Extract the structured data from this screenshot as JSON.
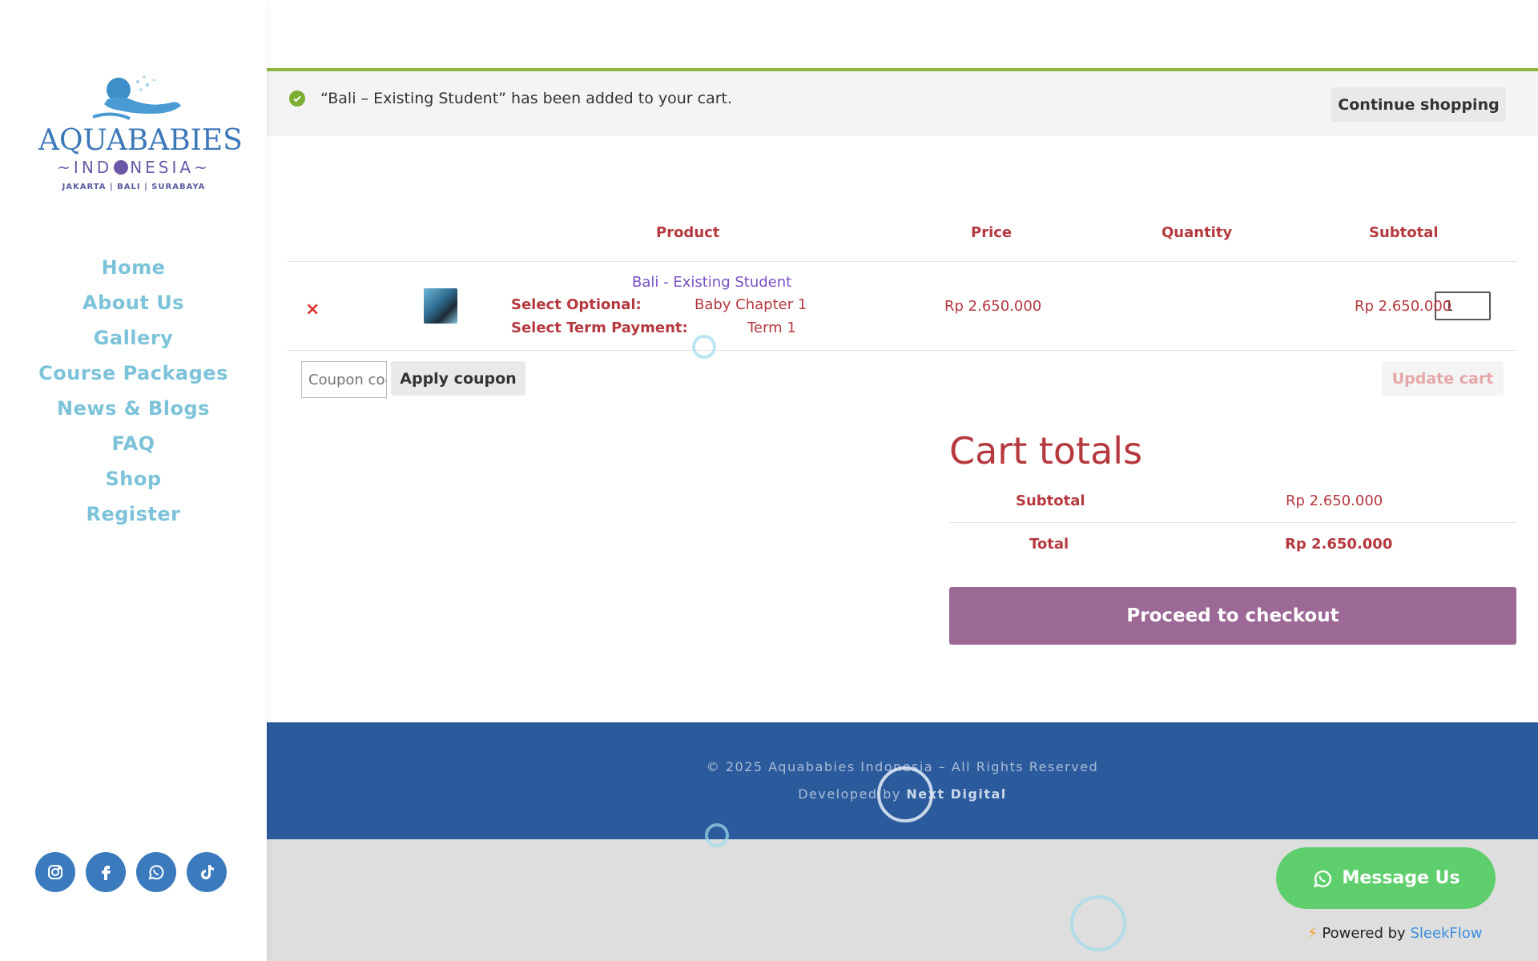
{
  "sidebar": {
    "logo": {
      "word": "AQUABABIES",
      "sub_before": "~IND",
      "sub_after": "NESIA~",
      "cities": "JAKARTA | BALI | SURABAYA"
    },
    "nav": [
      "Home",
      "About Us",
      "Gallery",
      "Course Packages",
      "News & Blogs",
      "FAQ",
      "Shop",
      "Register"
    ],
    "social": [
      "instagram-icon",
      "facebook-icon",
      "whatsapp-icon",
      "tiktok-icon"
    ]
  },
  "notice": {
    "message": "“Bali – Existing Student” has been added to your cart.",
    "continue_label": "Continue shopping"
  },
  "cart": {
    "headers": {
      "product": "Product",
      "price": "Price",
      "quantity": "Quantity",
      "subtotal": "Subtotal"
    },
    "item": {
      "remove": "×",
      "name": "Bali - Existing Student",
      "meta": [
        {
          "label": "Select Optional:",
          "value": "Baby Chapter 1"
        },
        {
          "label": "Select Term Payment:",
          "value": "Term 1"
        }
      ],
      "price": "Rp 2.650.000",
      "quantity": "1",
      "subtotal": "Rp 2.650.000"
    },
    "coupon_placeholder": "Coupon code",
    "apply_coupon_label": "Apply coupon",
    "update_cart_label": "Update cart"
  },
  "totals": {
    "title": "Cart totals",
    "subtotal_label": "Subtotal",
    "subtotal_value": "Rp 2.650.000",
    "total_label": "Total",
    "total_value": "Rp 2.650.000",
    "checkout_label": "Proceed to checkout"
  },
  "footer": {
    "copyright": "© 2025 Aquababies Indonesia – All Rights Reserved",
    "developed_prefix": "Developed by ",
    "developer": "Next Digital"
  },
  "chat_widget": {
    "button_label": "Message Us",
    "powered_prefix": "Powered by ",
    "powered_brand": "SleekFlow"
  },
  "colors": {
    "brand_red": "#b5393f",
    "nav_blue": "#7cc3d9",
    "checkout_purple": "#9c6895",
    "footer_blue": "#2b5b9c",
    "success_green": "#7cae34",
    "whatsapp_green": "#5fcf6d"
  }
}
